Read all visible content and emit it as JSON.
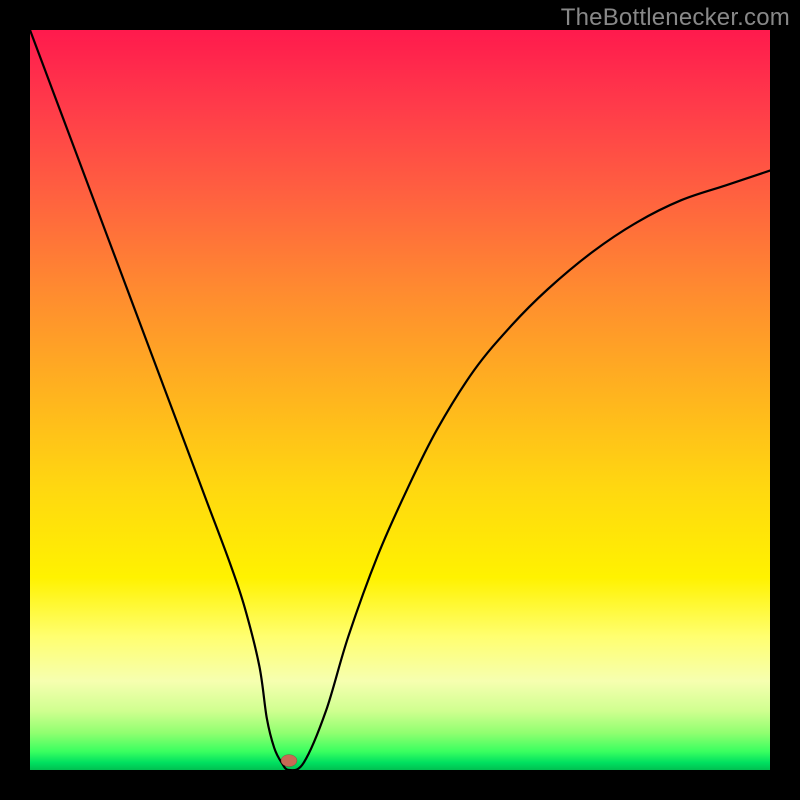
{
  "watermark": {
    "text": "TheBottlenecker.com"
  },
  "chart_data": {
    "type": "line",
    "title": "",
    "xlabel": "",
    "ylabel": "",
    "xlim": [
      0,
      100
    ],
    "ylim": [
      0,
      100
    ],
    "series": [
      {
        "name": "curve",
        "x": [
          0,
          3,
          6,
          9,
          12,
          15,
          18,
          21,
          24,
          27,
          29,
          31,
          32,
          33,
          34,
          35,
          37,
          40,
          43,
          47,
          51,
          55,
          60,
          65,
          70,
          76,
          82,
          88,
          94,
          100
        ],
        "values": [
          100,
          92,
          84,
          76,
          68,
          60,
          52,
          44,
          36,
          28,
          22,
          14,
          7,
          3,
          1,
          0,
          1,
          8,
          18,
          29,
          38,
          46,
          54,
          60,
          65,
          70,
          74,
          77,
          79,
          81
        ]
      }
    ],
    "marker": {
      "x": 35,
      "y": 1,
      "color": "#c86a55"
    },
    "background_gradient": [
      "#ff1a4d",
      "#ff6040",
      "#ffb020",
      "#fff200",
      "#ffff70",
      "#d0ff90",
      "#3aff60",
      "#00c050"
    ]
  }
}
